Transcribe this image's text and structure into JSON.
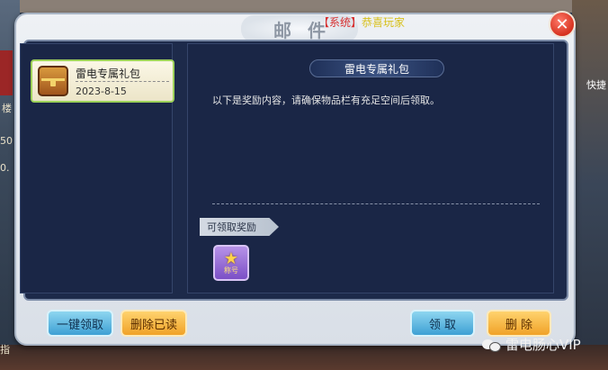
{
  "window": {
    "title": "邮件",
    "ticker_prefix": "【系统】",
    "ticker_text": "恭喜玩家"
  },
  "mail_list": [
    {
      "name": "雷电专属礼包",
      "date": "2023-8-15"
    }
  ],
  "detail": {
    "title": "雷电专属礼包",
    "body": "以下是奖励内容，请确保物品栏有充足空间后领取。",
    "reward_section_label": "可领取奖励",
    "reward_item_label": "称号"
  },
  "buttons": {
    "claim_all": "一键领取",
    "delete_read": "删除已读",
    "claim": "领 取",
    "delete": "删 除"
  },
  "background": {
    "side_right_label": "快捷",
    "side_left_1": "楼",
    "side_left_2": "50",
    "side_left_3": "0.",
    "side_left_4": "指"
  },
  "watermark": "雷电肠心VIP"
}
